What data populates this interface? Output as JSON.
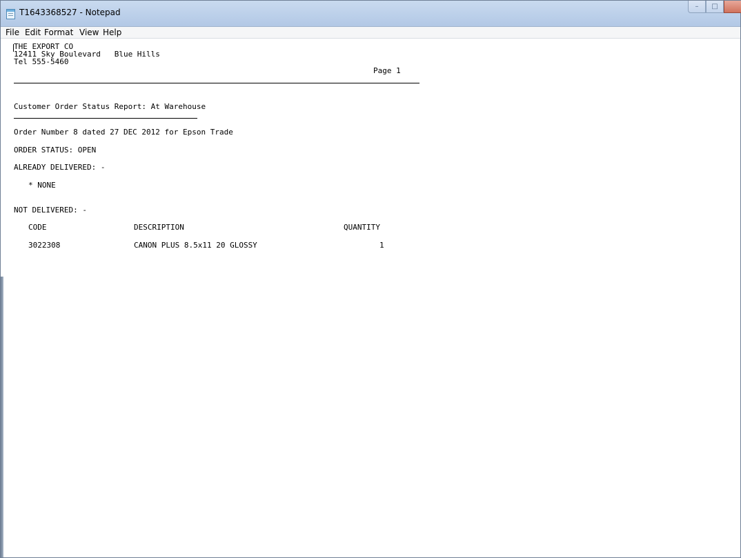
{
  "window": {
    "title": "T1643368527 - Notepad"
  },
  "menu": [
    "File",
    "Edit",
    "Format",
    "View",
    "Help"
  ],
  "document": {
    "company": "THE EXPORT CO",
    "address": "12411 Sky Boulevard   Blue Hills",
    "phone": "Tel 555-5460",
    "page": "Page 1",
    "report_title": "Customer Order Status Report: At Warehouse",
    "order_line": "Order Number 8 dated 27 DEC 2012 for Epson Trade",
    "order_status": "ORDER STATUS: OPEN",
    "already_delivered_label": "ALREADY DELIVERED: -",
    "already_delivered_value": "* NONE",
    "not_delivered_label": "NOT DELIVERED: -",
    "columns": [
      "CODE",
      "DESCRIPTION",
      "QUANTITY"
    ],
    "rows": [
      {
        "code": "3022308",
        "description": "CANON PLUS 8.5x11 20 GLOSSY",
        "quantity": "1"
      }
    ]
  }
}
